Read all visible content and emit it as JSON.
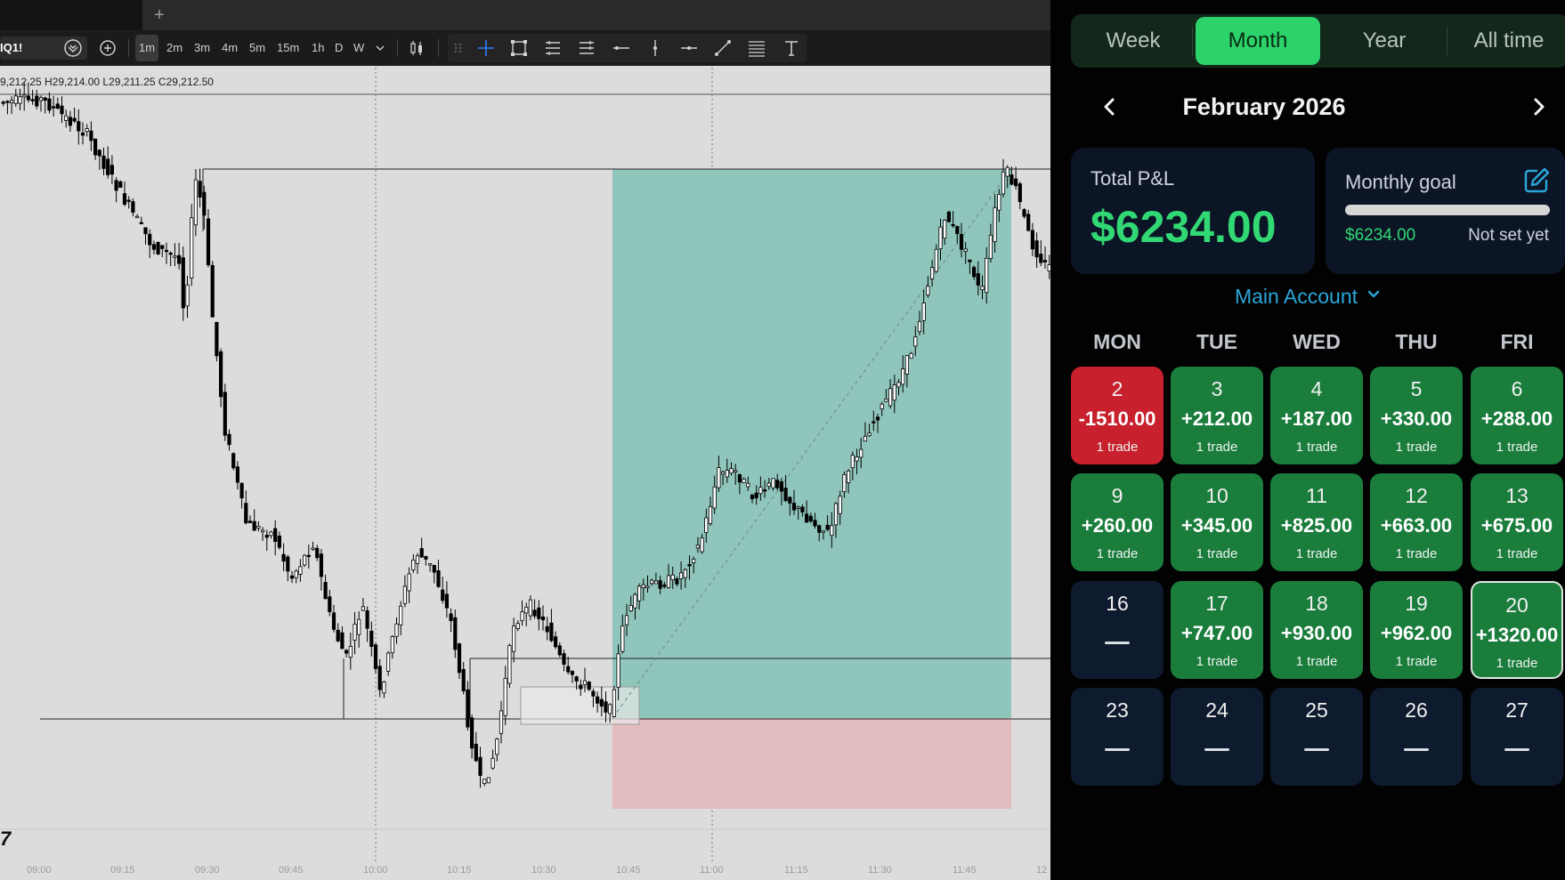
{
  "chart_app": {
    "symbol": "IQ1!",
    "timeframes": [
      "1m",
      "2m",
      "3m",
      "4m",
      "5m",
      "15m",
      "1h",
      "D",
      "W"
    ],
    "active_timeframe": "1m",
    "ohlc_text": "9,212.25  H29,214.00  L29,211.25  C29,212.50",
    "time_labels": [
      "09:00",
      "09:15",
      "09:30",
      "09:45",
      "10:00",
      "10:15",
      "10:30",
      "10:45",
      "11:00",
      "11:15",
      "11:30",
      "11:45",
      "12"
    ],
    "tab_plus": "+",
    "logo_text": "7",
    "colors": {
      "background": "#dcdcdc",
      "profit_zone": "#8fc5bb",
      "loss_zone": "#e3bcc0",
      "candle_up": "#ffffff",
      "candle_down": "#000000"
    }
  },
  "journal": {
    "periods": [
      "Week",
      "Month",
      "Year",
      "All time"
    ],
    "active_period": "Month",
    "month_title": "February 2026",
    "total_pnl_label": "Total P&L",
    "total_pnl_value": "$6234.00",
    "monthly_goal_label": "Monthly goal",
    "monthly_goal_current": "$6234.00",
    "monthly_goal_target": "Not set yet",
    "monthly_goal_progress": 0.0,
    "account_name": "Main Account",
    "weekdays": [
      "MON",
      "TUE",
      "WED",
      "THU",
      "FRI"
    ],
    "days": [
      {
        "day": "2",
        "pnl": "-1510.00",
        "trades": "1 trade",
        "status": "loss"
      },
      {
        "day": "3",
        "pnl": "+212.00",
        "trades": "1 trade",
        "status": "win"
      },
      {
        "day": "4",
        "pnl": "+187.00",
        "trades": "1 trade",
        "status": "win"
      },
      {
        "day": "5",
        "pnl": "+330.00",
        "trades": "1 trade",
        "status": "win"
      },
      {
        "day": "6",
        "pnl": "+288.00",
        "trades": "1 trade",
        "status": "win"
      },
      {
        "day": "9",
        "pnl": "+260.00",
        "trades": "1 trade",
        "status": "win"
      },
      {
        "day": "10",
        "pnl": "+345.00",
        "trades": "1 trade",
        "status": "win"
      },
      {
        "day": "11",
        "pnl": "+825.00",
        "trades": "1 trade",
        "status": "win"
      },
      {
        "day": "12",
        "pnl": "+663.00",
        "trades": "1 trade",
        "status": "win"
      },
      {
        "day": "13",
        "pnl": "+675.00",
        "trades": "1 trade",
        "status": "win"
      },
      {
        "day": "16",
        "pnl": "",
        "trades": "",
        "status": "none"
      },
      {
        "day": "17",
        "pnl": "+747.00",
        "trades": "1 trade",
        "status": "win"
      },
      {
        "day": "18",
        "pnl": "+930.00",
        "trades": "1 trade",
        "status": "win"
      },
      {
        "day": "19",
        "pnl": "+962.00",
        "trades": "1 trade",
        "status": "win"
      },
      {
        "day": "20",
        "pnl": "+1320.00",
        "trades": "1 trade",
        "status": "win-today"
      },
      {
        "day": "23",
        "pnl": "",
        "trades": "",
        "status": "none"
      },
      {
        "day": "24",
        "pnl": "",
        "trades": "",
        "status": "none"
      },
      {
        "day": "25",
        "pnl": "",
        "trades": "",
        "status": "none"
      },
      {
        "day": "26",
        "pnl": "",
        "trades": "",
        "status": "none"
      },
      {
        "day": "27",
        "pnl": "",
        "trades": "",
        "status": "none"
      }
    ],
    "colors": {
      "accent": "#2cd36a",
      "profit_text": "#31d873",
      "loss_cell": "#c8202c",
      "win_cell": "#1a7d3c",
      "empty_cell": "#0e1a2e",
      "account": "#2aa7d9"
    }
  }
}
